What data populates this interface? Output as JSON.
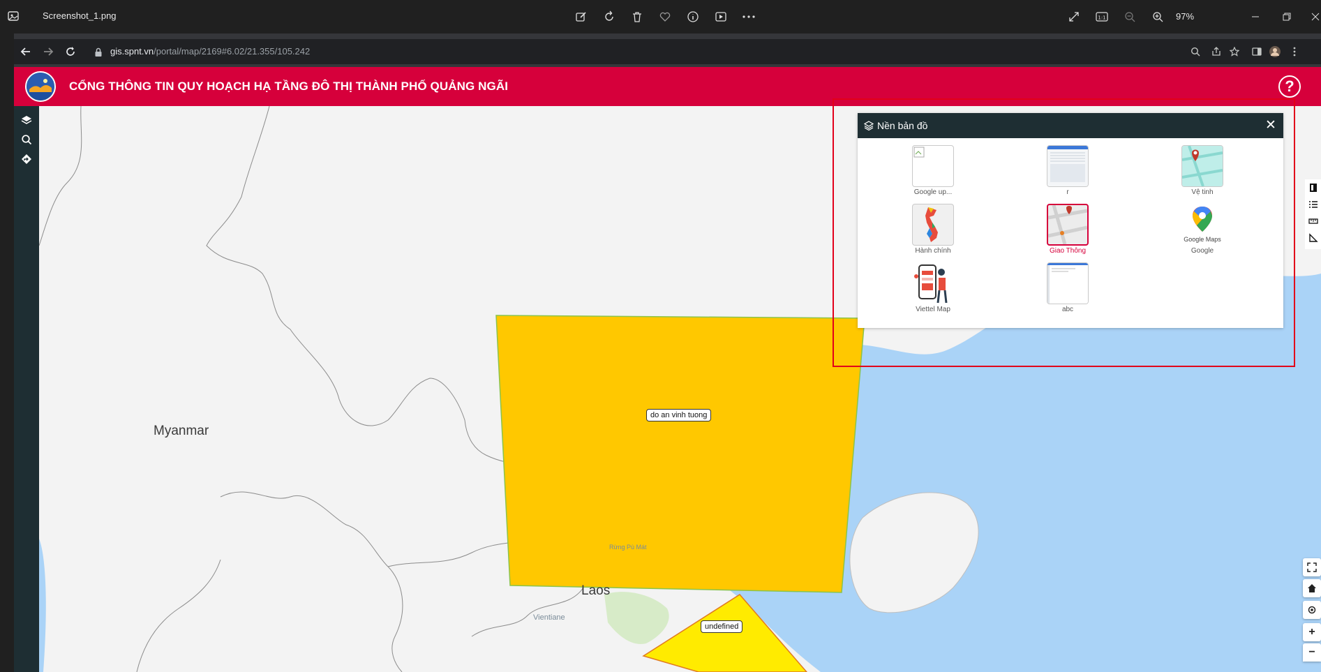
{
  "viewer": {
    "file_name": "Screenshot_1.png",
    "zoom": "97%",
    "icons": [
      "photos-app-icon",
      "edit-icon",
      "rotate-icon",
      "delete-icon",
      "favorite-icon",
      "info-icon",
      "slideshow-icon",
      "more-icon",
      "fullscreen-icon",
      "actual-size-icon",
      "zoom-out-icon",
      "zoom-in-icon",
      "minimize-icon",
      "restore-icon",
      "close-icon"
    ]
  },
  "browser": {
    "url_host": "gis.spnt.vn",
    "url_path": "/portal/map/2169#6.02/21.355/105.242"
  },
  "header": {
    "title": "CỔNG THÔNG TIN QUY HOẠCH HẠ TẦNG ĐÔ THỊ THÀNH PHỐ QUẢNG NGÃI",
    "help": "?",
    "brand_color": "#d6003b"
  },
  "map": {
    "labels": {
      "myanmar": "Myanmar",
      "laos": "Laos",
      "vientiane": "Vientiane",
      "rung_pu_mat": "Rừng Pù Mát"
    },
    "polygons": [
      {
        "label": "do an vinh tuong",
        "color": "#ffc800"
      },
      {
        "label": "undefined",
        "color": "#ffeb00"
      }
    ],
    "water_color": "#aad3f7"
  },
  "basemap_panel": {
    "title": "Nền bản đồ",
    "close": "✕",
    "items": [
      {
        "label": "Google up...",
        "active": false
      },
      {
        "label": "r",
        "active": false
      },
      {
        "label": "Vệ tinh",
        "active": false
      },
      {
        "label": "Hành chính",
        "active": false
      },
      {
        "label": "Giao Thông",
        "active": true
      },
      {
        "label": "Google",
        "active": false
      },
      {
        "label": "Viettel Map",
        "active": false
      },
      {
        "label": "abc",
        "active": false
      }
    ],
    "google_maps_logo_text": "Google Maps"
  },
  "controls": {
    "zoom_in": "+",
    "zoom_out": "−"
  }
}
